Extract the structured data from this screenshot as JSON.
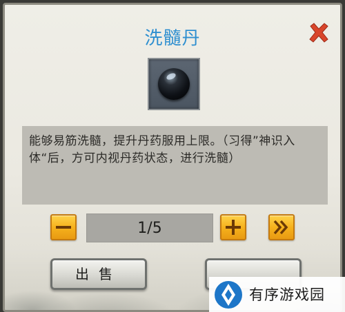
{
  "dialog": {
    "title": "洗髓丹",
    "item_icon": "black-pill-icon",
    "description": "能够易筋洗髓，提升丹药服用上限。（习得”神识入体“后，方可内视丹药状态，进行洗髓）"
  },
  "quantity": {
    "display": "1/5",
    "current": 1,
    "max": 5
  },
  "buttons": {
    "minus_icon": "minus-icon",
    "plus_icon": "plus-icon",
    "max_icon": "double-chevron-right-icon",
    "close_icon": "close-icon",
    "sell_label": "出售"
  },
  "watermark": {
    "text": "有序游戏园"
  },
  "colors": {
    "title": "#2e8fd0",
    "close": "#d9462b",
    "button_gold": "#f6b21d"
  }
}
